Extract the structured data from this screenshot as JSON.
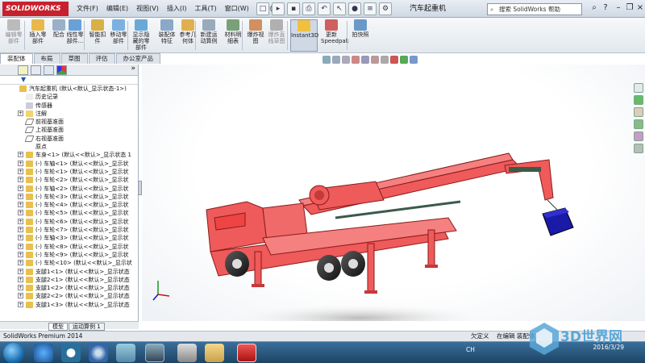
{
  "app": {
    "logo": "SOLIDWORKS",
    "doc_title": "汽车起重机",
    "help_placeholder": "搜索 SolidWorks 帮助"
  },
  "menus": [
    "文件(F)",
    "编辑(E)",
    "视图(V)",
    "插入(I)",
    "工具(T)",
    "窗口(W)",
    "帮助(H)"
  ],
  "commands": [
    {
      "label": "编辑零\n部件",
      "icon": "edit-component-icon",
      "dim": true
    },
    {
      "label": "插入零\n部件",
      "icon": "insert-component-icon"
    },
    {
      "label": "配合",
      "icon": "mate-icon"
    },
    {
      "label": "线性零\n部件...",
      "icon": "linear-pattern-icon"
    },
    {
      "label": "智能扣\n件",
      "icon": "smart-fastener-icon"
    },
    {
      "label": "移动零\n部件",
      "icon": "move-component-icon"
    },
    {
      "label": "显示隐\n藏的零\n部件",
      "icon": "show-hidden-icon"
    },
    {
      "label": "装配体\n特征",
      "icon": "assembly-feature-icon"
    },
    {
      "label": "参考几\n何体",
      "icon": "reference-geometry-icon"
    },
    {
      "label": "新建运\n动算例",
      "icon": "new-motion-study-icon"
    },
    {
      "label": "材料明\n细表",
      "icon": "bom-icon"
    },
    {
      "label": "爆炸视\n图",
      "icon": "exploded-view-icon"
    },
    {
      "label": "爆炸直\n线草图",
      "icon": "explode-line-sketch-icon",
      "dim": true
    },
    {
      "label": "Instant3D",
      "icon": "instant3d-icon",
      "active": true
    },
    {
      "label": "更新\nSpeedpak",
      "icon": "speedpak-icon"
    },
    {
      "label": "拍快照",
      "icon": "snapshot-icon"
    }
  ],
  "cm_tabs": [
    "装配体",
    "布局",
    "草图",
    "评估",
    "办公室产品"
  ],
  "tree": {
    "root": "汽车起重机 (默认<默认_显示状态-1>)",
    "items": [
      {
        "label": "历史记录",
        "icon": "history-icon",
        "pm": ""
      },
      {
        "label": "传感器",
        "icon": "sensor-icon",
        "pm": ""
      },
      {
        "label": "注解",
        "icon": "annotation-icon",
        "pm": "+"
      },
      {
        "label": "前视基准面",
        "icon": "plane-icon",
        "pm": ""
      },
      {
        "label": "上视基准面",
        "icon": "plane-icon",
        "pm": ""
      },
      {
        "label": "右视基准面",
        "icon": "plane-icon",
        "pm": ""
      },
      {
        "label": "原点",
        "icon": "origin-icon",
        "pm": ""
      },
      {
        "label": "车身<1> (默认<<默认>_显示状态 1",
        "icon": "part-icon",
        "pm": "+"
      },
      {
        "label": "(-) 车轴<1> (默认<<默认>_显示状",
        "icon": "part-icon",
        "pm": "+"
      },
      {
        "label": "(-) 车轮<1> (默认<<默认>_显示状",
        "icon": "part-icon",
        "pm": "+"
      },
      {
        "label": "(-) 车轮<2> (默认<<默认>_显示状",
        "icon": "part-icon",
        "pm": "+"
      },
      {
        "label": "(-) 车轴<2> (默认<<默认>_显示状",
        "icon": "part-icon",
        "pm": "+"
      },
      {
        "label": "(-) 车轮<3> (默认<<默认>_显示状",
        "icon": "part-icon",
        "pm": "+"
      },
      {
        "label": "(-) 车轮<4> (默认<<默认>_显示状",
        "icon": "part-icon",
        "pm": "+"
      },
      {
        "label": "(-) 车轮<5> (默认<<默认>_显示状",
        "icon": "part-icon",
        "pm": "+"
      },
      {
        "label": "(-) 车轮<6> (默认<<默认>_显示状",
        "icon": "part-icon",
        "pm": "+"
      },
      {
        "label": "(-) 车轮<7> (默认<<默认>_显示状",
        "icon": "part-icon",
        "pm": "+"
      },
      {
        "label": "(-) 车轴<3> (默认<<默认>_显示状",
        "icon": "part-icon",
        "pm": "+"
      },
      {
        "label": "(-) 车轮<8> (默认<<默认>_显示状",
        "icon": "part-icon",
        "pm": "+"
      },
      {
        "label": "(-) 车轮<9> (默认<<默认>_显示状",
        "icon": "part-icon",
        "pm": "+"
      },
      {
        "label": "(-) 车轮<10> (默认<<默认>_显示状",
        "icon": "part-icon",
        "pm": "+"
      },
      {
        "label": "支腿1<1> (默认<<默认>_显示状态",
        "icon": "part-icon",
        "pm": "+"
      },
      {
        "label": "支腿2<1> (默认<<默认>_显示状态",
        "icon": "part-icon",
        "pm": "+"
      },
      {
        "label": "支腿1<2> (默认<<默认>_显示状态",
        "icon": "part-icon",
        "pm": "+"
      },
      {
        "label": "支腿2<2> (默认<<默认>_显示状态",
        "icon": "part-icon",
        "pm": "+"
      },
      {
        "label": "支腿1<3> (默认<<默认>_显示状态",
        "icon": "part-icon",
        "pm": "+"
      }
    ]
  },
  "bottom_tabs": [
    "模型",
    "运动算例 1"
  ],
  "status": {
    "product": "SolidWorks Premium 2014",
    "defined": "欠定义",
    "editing": "在编辑 装配体"
  },
  "taskbar": {
    "lang": "CH",
    "time": "",
    "date": "2016/3/29"
  },
  "watermark": "3D世界网",
  "colors": {
    "part_red": "#ef5a5a",
    "box_blue": "#1a1aa8",
    "accent": "#c8202c"
  }
}
